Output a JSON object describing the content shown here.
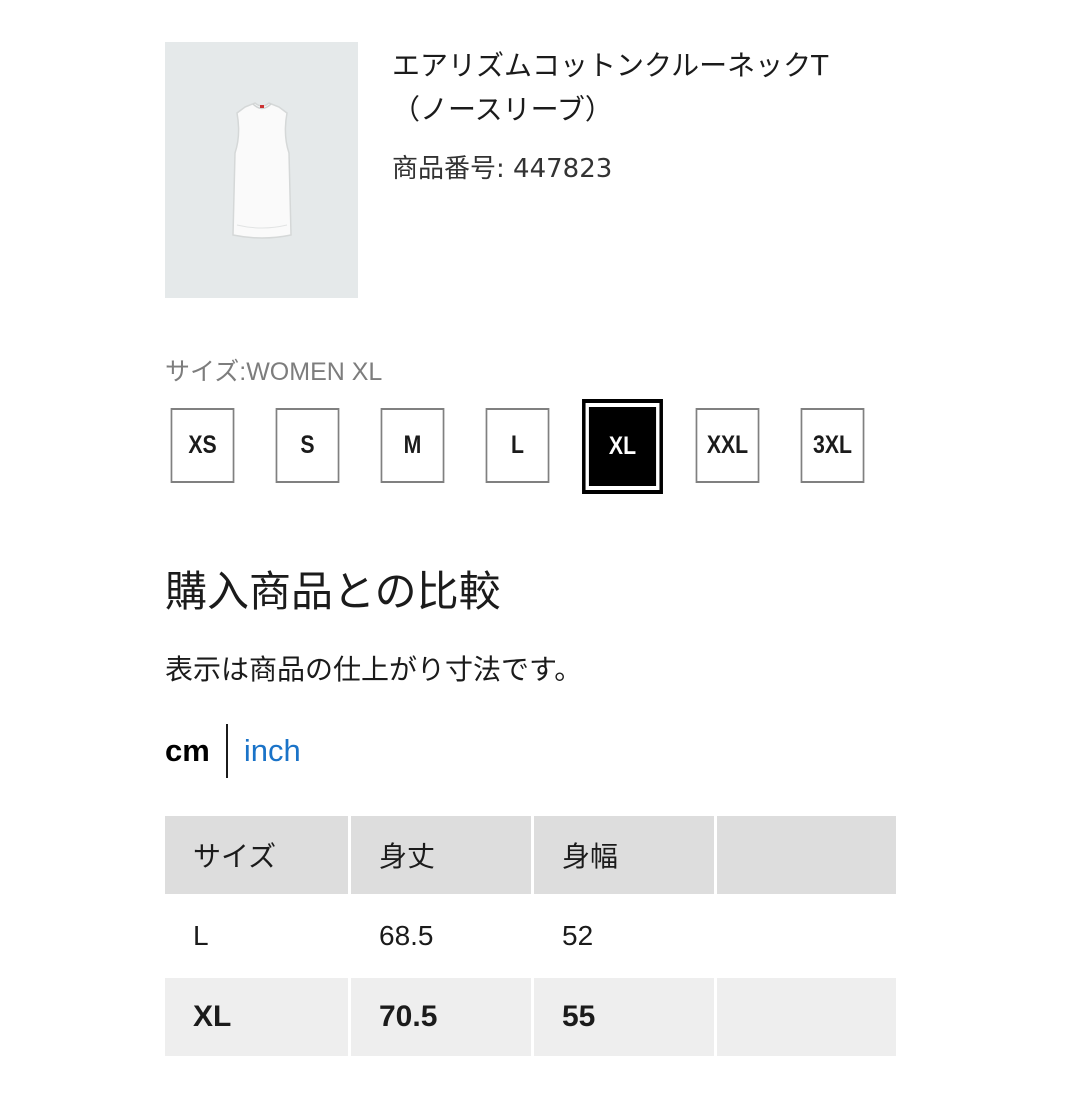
{
  "product": {
    "name_line1": "エアリズムコットンクルーネックT",
    "name_line2": "（ノースリーブ）",
    "code": "商品番号: 447823"
  },
  "size_selector": {
    "label": "サイズ:WOMEN XL",
    "options": [
      "XS",
      "S",
      "M",
      "L",
      "XL",
      "XXL",
      "3XL"
    ],
    "selected": "XL"
  },
  "comparison": {
    "title": "購入商品との比較",
    "note": "表示は商品の仕上がり寸法です。"
  },
  "units": {
    "cm": "cm",
    "inch": "inch",
    "active": "cm",
    "inch_color": "#1a73c8"
  },
  "size_table": {
    "headers": [
      "サイズ",
      "身丈",
      "身幅",
      ""
    ],
    "rows": [
      [
        "L",
        "68.5",
        "52",
        ""
      ],
      [
        "XL",
        "70.5",
        "55",
        ""
      ]
    ],
    "highlighted_row": "XL"
  }
}
